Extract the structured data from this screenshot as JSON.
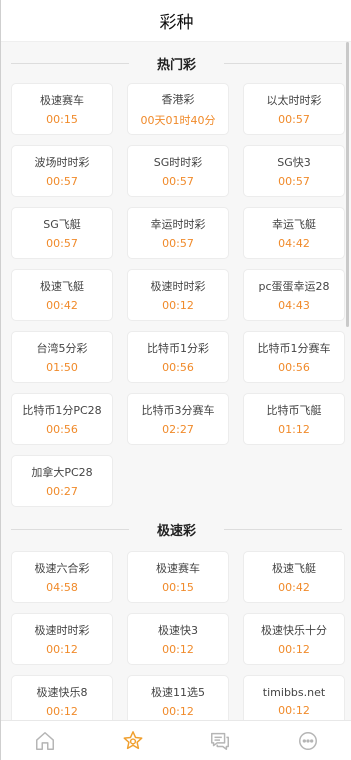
{
  "header": {
    "title": "彩种"
  },
  "sections": [
    {
      "title": "热门彩",
      "items": [
        {
          "name": "极速赛车",
          "time": "00:15"
        },
        {
          "name": "香港彩",
          "time": "00天01时40分"
        },
        {
          "name": "以太时时彩",
          "time": "00:57"
        },
        {
          "name": "波场时时彩",
          "time": "00:57"
        },
        {
          "name": "SG时时彩",
          "time": "00:57"
        },
        {
          "name": "SG快3",
          "time": "00:57"
        },
        {
          "name": "SG飞艇",
          "time": "00:57"
        },
        {
          "name": "幸运时时彩",
          "time": "00:57"
        },
        {
          "name": "幸运飞艇",
          "time": "04:42"
        },
        {
          "name": "极速飞艇",
          "time": "00:42"
        },
        {
          "name": "极速时时彩",
          "time": "00:12"
        },
        {
          "name": "pc蛋蛋幸运28",
          "time": "04:43"
        },
        {
          "name": "台湾5分彩",
          "time": "01:50"
        },
        {
          "name": "比特币1分彩",
          "time": "00:56"
        },
        {
          "name": "比特币1分赛车",
          "time": "00:56"
        },
        {
          "name": "比特币1分PC28",
          "time": "00:56"
        },
        {
          "name": "比特币3分赛车",
          "time": "02:27"
        },
        {
          "name": "比特币飞艇",
          "time": "01:12"
        },
        {
          "name": "加拿大PC28",
          "time": "00:27"
        }
      ]
    },
    {
      "title": "极速彩",
      "items": [
        {
          "name": "极速六合彩",
          "time": "04:58"
        },
        {
          "name": "极速赛车",
          "time": "00:15"
        },
        {
          "name": "极速飞艇",
          "time": "00:42"
        },
        {
          "name": "极速时时彩",
          "time": "00:12"
        },
        {
          "name": "极速快3",
          "time": "00:12"
        },
        {
          "name": "极速快乐十分",
          "time": "00:12"
        },
        {
          "name": "极速快乐8",
          "time": "00:12"
        },
        {
          "name": "极速11选5",
          "time": "00:12"
        },
        {
          "name": "timibbs.net",
          "time": "00:12"
        }
      ]
    }
  ],
  "tabbar": {
    "active_index": 1,
    "tabs": [
      {
        "icon": "home-icon"
      },
      {
        "icon": "lottery-icon"
      },
      {
        "icon": "chat-icon"
      },
      {
        "icon": "more-icon"
      }
    ]
  },
  "colors": {
    "accent": "#f08a2a",
    "active_tab": "#f0a030",
    "inactive_tab": "#b5b5b5"
  }
}
